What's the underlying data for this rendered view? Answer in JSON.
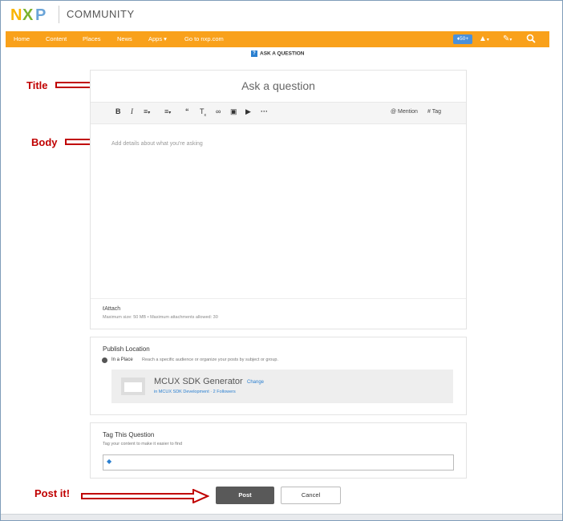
{
  "header": {
    "brand": "NXP",
    "community": "COMMUNITY"
  },
  "nav": {
    "items": [
      "Home",
      "Content",
      "Places",
      "News",
      "Apps ▾",
      "Go to nxp.com"
    ],
    "badge": "50+"
  },
  "ask_strip": "ASK A QUESTION",
  "annotations": {
    "title": "Title",
    "body": "Body",
    "post": "Post it!"
  },
  "editor": {
    "title_placeholder": "Ask a question",
    "toolbar": {
      "mention": "@ Mention",
      "tag": "# Tag"
    },
    "body_placeholder": "Add details about what you're asking",
    "attach": "Attach",
    "attach_hint": "Maximum size: 50 MB  •  Maximum attachments allowed: 30"
  },
  "publish": {
    "title": "Publish Location",
    "option": "In a Place",
    "description": "Reach a specific audience or organize your posts by subject or group.",
    "place_name": "MCUX SDK Generator",
    "change": "Change",
    "place_sub": "in MCUX SDK Development  ·  2 Followers"
  },
  "tags": {
    "title": "Tag This Question",
    "subtitle": "Tag your content to make it easier to find"
  },
  "buttons": {
    "post": "Post",
    "cancel": "Cancel"
  },
  "colors": {
    "nav_bg": "#f9a11b",
    "annotation": "#c00000",
    "link": "#2a7fd0",
    "post_bg": "#595959"
  }
}
